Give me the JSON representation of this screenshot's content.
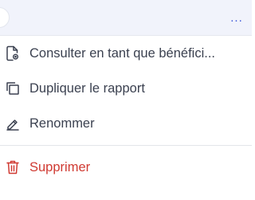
{
  "header": {
    "more_label": "..."
  },
  "menu": {
    "items": [
      {
        "label": "Consulter en tant que bénéfici...",
        "icon": "document-view-icon"
      },
      {
        "label": "Dupliquer le rapport",
        "icon": "duplicate-icon"
      },
      {
        "label": "Renommer",
        "icon": "pencil-icon"
      }
    ],
    "danger_item": {
      "label": "Supprimer",
      "icon": "trash-icon"
    }
  },
  "colors": {
    "accent": "#3b56d9",
    "text": "#3b4150",
    "danger": "#d03a32",
    "header_bg": "#f1f3fb"
  }
}
